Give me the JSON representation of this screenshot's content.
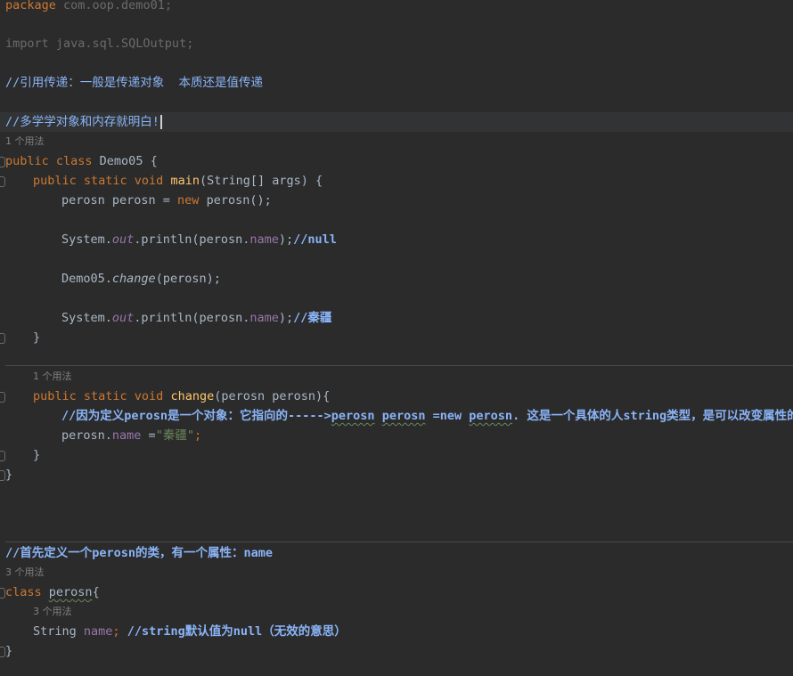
{
  "code": {
    "package_kw": "package",
    "package_name": " com.oop.demo01;",
    "import_line": "import java.sql.SQLOutput;",
    "comment_reference": "//引用传递：一般是传递对象  本质还是值传递",
    "comment_learn": "//多学学对象和内存就明白!",
    "usage_hint_demo05": "1 个用法",
    "class_decl_kw": "public class",
    "class_decl_name": " Demo05 {",
    "main_mods": "public static void",
    "main_name": "main",
    "main_params": "(String[] args) {",
    "l_new_a": "perosn perosn = ",
    "l_new_kw": "new",
    "l_new_b": " perosn();",
    "print1_a": "System.",
    "print1_out": "out",
    "print1_b": ".println(perosn.",
    "print1_name": "name",
    "print1_c": ");",
    "print1_comment": "//null",
    "call_a": "Demo05.",
    "call_change": "change",
    "call_b": "(perosn);",
    "print2_a": "System.",
    "print2_out": "out",
    "print2_b": ".println(perosn.",
    "print2_name": "name",
    "print2_c": ");",
    "print2_comment": "//秦疆",
    "close_main": "}",
    "usage_hint_change": "1 个用法",
    "change_mods": "public static void",
    "change_name": "change",
    "change_params": "(perosn perosn){",
    "change_comment_a": "//因为定义perosn是一个对象：它指向的----->",
    "change_comment_sq1": "perosn",
    "change_comment_sq2": "perosn",
    "change_comment_b": " =new ",
    "change_comment_sq3": "perosn",
    "change_comment_c": ". 这是一个具体的人string类型，是可以改变属性的！",
    "assign_a": "perosn.",
    "assign_name": "name",
    "assign_b": " =",
    "assign_str": "\"秦疆\"",
    "assign_c": ";",
    "close_change": "}",
    "close_class": "}",
    "comment_define": "//首先定义一个perosn的类，有一个属性：name",
    "usage_hint_perosn": "3 个用法",
    "perosn_kw": "class",
    "perosn_name": "perosn",
    "perosn_brace": "{",
    "usage_hint_field": "3 个用法",
    "field_type": "String ",
    "field_name": "name",
    "field_semi": ";",
    "field_comment": "//string默认值为null（无效的意思）",
    "close_perosn": "}"
  }
}
